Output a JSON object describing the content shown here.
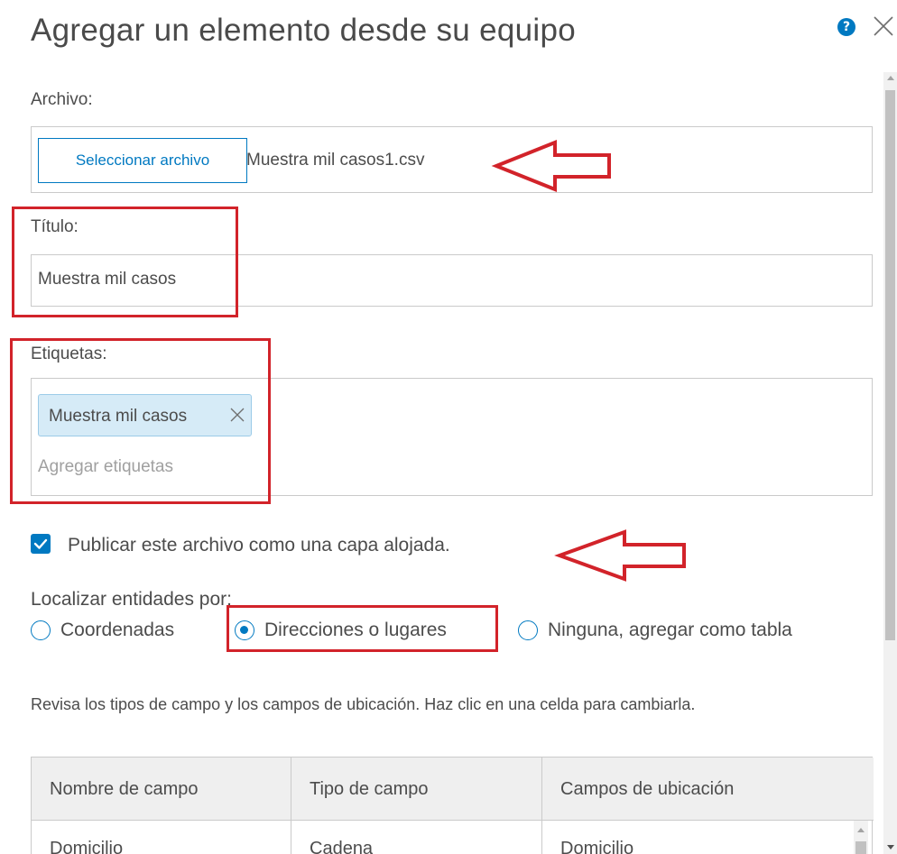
{
  "dialog": {
    "title": "Agregar un elemento desde su equipo",
    "help_icon": "question-circle-icon",
    "help_glyph": "?",
    "close_icon": "close-icon"
  },
  "file": {
    "label": "Archivo:",
    "button_label": "Seleccionar archivo",
    "file_name": "Muestra mil casos1.csv"
  },
  "title_field": {
    "label": "Título:",
    "value": "Muestra mil casos"
  },
  "tags": {
    "label": "Etiquetas:",
    "items": [
      {
        "label": "Muestra mil casos",
        "remove_icon": "close-icon"
      }
    ],
    "placeholder": "Agregar etiquetas"
  },
  "publish": {
    "checked": true,
    "label": "Publicar este archivo como una capa alojada."
  },
  "locate": {
    "label": "Localizar entidades por:",
    "options": [
      {
        "label": "Coordenadas",
        "selected": false
      },
      {
        "label": "Direcciones o lugares",
        "selected": true
      },
      {
        "label": "Ninguna, agregar como tabla",
        "selected": false
      }
    ]
  },
  "fields_help": "Revisa los tipos de campo y los campos de ubicación. Haz clic en una celda para cambiarla.",
  "fields_table": {
    "columns": [
      "Nombre de campo",
      "Tipo de campo",
      "Campos de ubicación"
    ],
    "rows": [
      [
        "Domicilio",
        "Cadena",
        "Domicilio"
      ]
    ]
  },
  "colors": {
    "accent": "#0079c1",
    "annotation": "#d2232a",
    "tag_background": "#d6ebf7"
  }
}
